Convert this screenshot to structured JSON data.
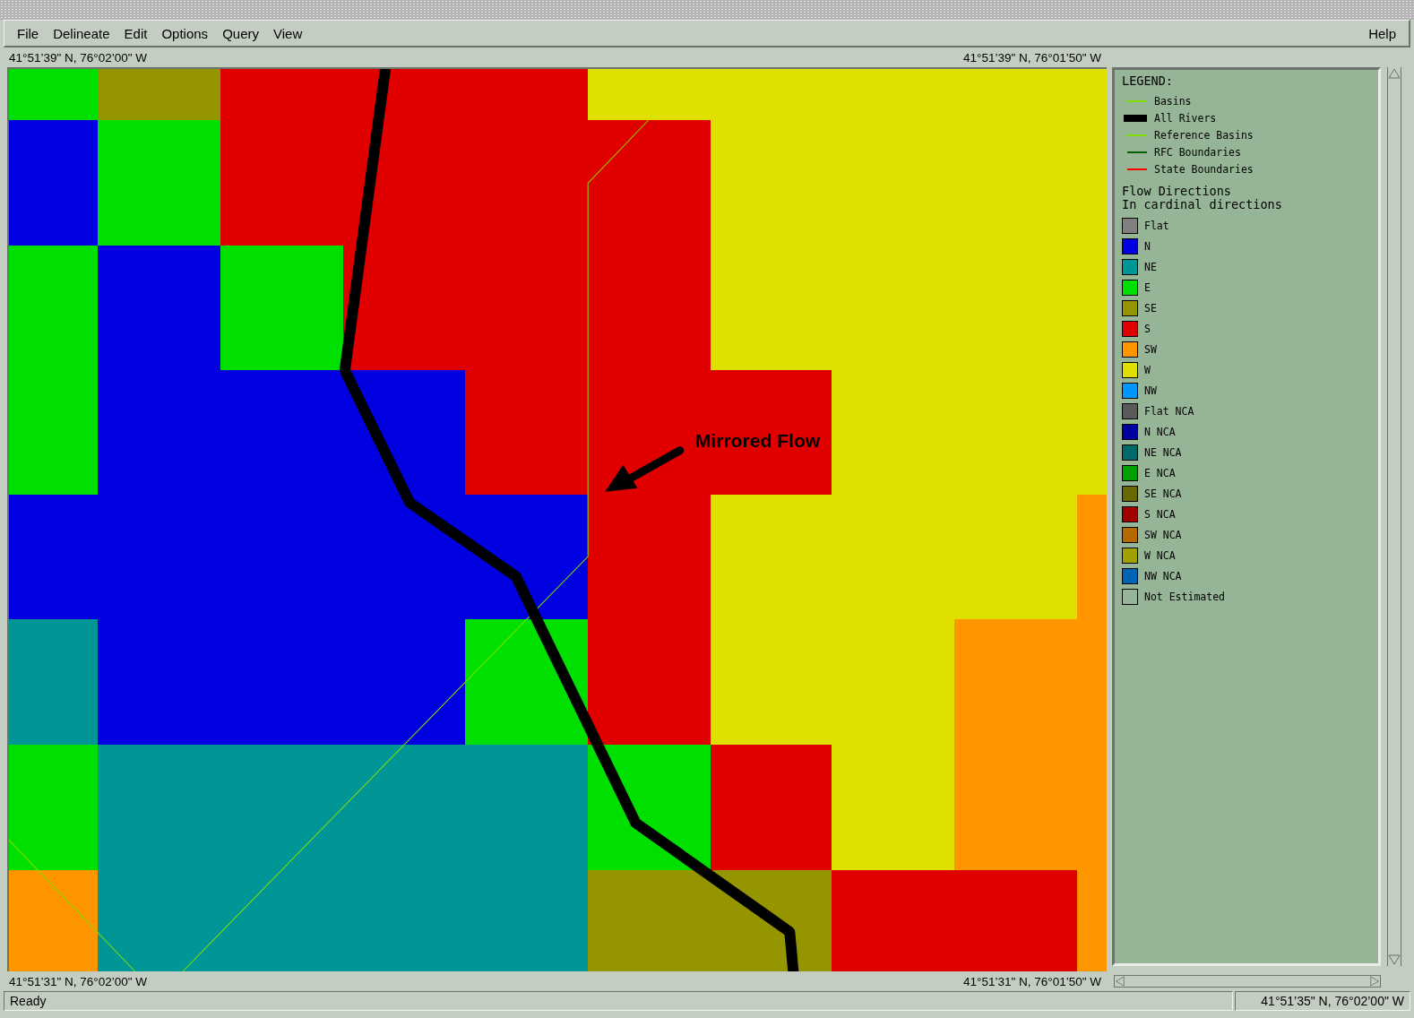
{
  "menu": {
    "left": [
      {
        "label": "File"
      },
      {
        "label": "Delineate"
      },
      {
        "label": "Edit"
      },
      {
        "label": "Options"
      },
      {
        "label": "Query"
      },
      {
        "label": "View"
      }
    ],
    "right": [
      {
        "label": "Help"
      }
    ]
  },
  "coords": {
    "top_left": "41°51’39\" N, 76°02’00\" W",
    "top_right": "41°51’39\" N, 76°01’50\" W",
    "bottom_left": "41°51’31\" N, 76°02’00\" W",
    "bottom_right": "41°51’31\" N, 76°01’50\" W"
  },
  "map": {
    "annotation": "Mirrored Flow",
    "rows": [
      {
        "cells": [
          {
            "color": "#00e000"
          },
          {
            "color": "#959500"
          },
          {
            "color": "#e00000"
          },
          {
            "color": "#e00000"
          },
          {
            "color": "#e00000"
          },
          {
            "color": "#e0e000"
          },
          {
            "color": "#e0e000"
          },
          {
            "color": "#e0e000"
          },
          {
            "color": "#e0e000"
          },
          {
            "color": "#e0e000"
          }
        ]
      },
      {
        "cells": [
          {
            "color": "#0000e0"
          },
          {
            "color": "#00e000"
          },
          {
            "color": "#e00000"
          },
          {
            "color": "#e00000"
          },
          {
            "color": "#e00000"
          },
          {
            "color": "#e00000"
          },
          {
            "color": "#e0e000"
          },
          {
            "color": "#e0e000"
          },
          {
            "color": "#e0e000"
          },
          {
            "color": "#e0e000"
          }
        ]
      },
      {
        "cells": [
          {
            "color": "#00e000"
          },
          {
            "color": "#0000e0"
          },
          {
            "color": "#00e000"
          },
          {
            "color": "#e00000"
          },
          {
            "color": "#e00000"
          },
          {
            "color": "#e00000"
          },
          {
            "color": "#e0e000"
          },
          {
            "color": "#e0e000"
          },
          {
            "color": "#e0e000"
          },
          {
            "color": "#e0e000"
          }
        ]
      },
      {
        "cells": [
          {
            "color": "#00e000"
          },
          {
            "color": "#0000e0"
          },
          {
            "color": "#0000e0"
          },
          {
            "color": "#0000e0"
          },
          {
            "color": "#e00000"
          },
          {
            "color": "#e00000"
          },
          {
            "color": "#e00000"
          },
          {
            "color": "#e0e000"
          },
          {
            "color": "#e0e000"
          },
          {
            "color": "#e0e000"
          }
        ]
      },
      {
        "cells": [
          {
            "color": "#0000e0"
          },
          {
            "color": "#0000e0"
          },
          {
            "color": "#0000e0"
          },
          {
            "color": "#0000e0"
          },
          {
            "color": "#0000e0"
          },
          {
            "color": "#e00000"
          },
          {
            "color": "#e0e000"
          },
          {
            "color": "#e0e000"
          },
          {
            "color": "#e0e000"
          },
          {
            "color": "#ff9600"
          }
        ]
      },
      {
        "cells": [
          {
            "color": "#009696"
          },
          {
            "color": "#0000e0"
          },
          {
            "color": "#0000e0"
          },
          {
            "color": "#0000e0"
          },
          {
            "color": "#00e000"
          },
          {
            "color": "#e00000"
          },
          {
            "color": "#e0e000"
          },
          {
            "color": "#e0e000"
          },
          {
            "color": "#ff9600"
          },
          {
            "color": "#ff9600"
          }
        ]
      },
      {
        "cells": [
          {
            "color": "#00e000"
          },
          {
            "color": "#009696"
          },
          {
            "color": "#009696"
          },
          {
            "color": "#009696"
          },
          {
            "color": "#009696"
          },
          {
            "color": "#00e000"
          },
          {
            "color": "#e00000"
          },
          {
            "color": "#e0e000"
          },
          {
            "color": "#ff9600"
          },
          {
            "color": "#ff9600"
          }
        ]
      },
      {
        "cells": [
          {
            "color": "#ff9600"
          },
          {
            "color": "#009696"
          },
          {
            "color": "#009696"
          },
          {
            "color": "#009696"
          },
          {
            "color": "#009696"
          },
          {
            "color": "#959500"
          },
          {
            "color": "#959500"
          },
          {
            "color": "#e00000"
          },
          {
            "color": "#e00000"
          },
          {
            "color": "#ff9600"
          }
        ]
      }
    ]
  },
  "legend": {
    "title": "LEGEND:",
    "layers": [
      {
        "kind": "line",
        "label": "Basins",
        "color": "#80e000"
      },
      {
        "kind": "thick",
        "label": "All Rivers",
        "color": "#000000"
      },
      {
        "kind": "line",
        "label": "Reference Basins",
        "color": "#80e000"
      },
      {
        "kind": "line",
        "label": "RFC Boundaries",
        "color": "#006000"
      },
      {
        "kind": "line",
        "label": "State Boundaries",
        "color": "#ff0000"
      }
    ],
    "heading": [
      "Flow Directions",
      "In cardinal directions"
    ],
    "classes": [
      {
        "label": "Flat",
        "color": "#808080"
      },
      {
        "label": "N",
        "color": "#0000e0"
      },
      {
        "label": "NE",
        "color": "#009696"
      },
      {
        "label": "E",
        "color": "#00e000"
      },
      {
        "label": "SE",
        "color": "#959500"
      },
      {
        "label": "S",
        "color": "#e00000"
      },
      {
        "label": "SW",
        "color": "#ff9600"
      },
      {
        "label": "W",
        "color": "#e0e000"
      },
      {
        "label": "NW",
        "color": "#0096ff"
      },
      {
        "label": "Flat NCA",
        "color": "#5a5a5a"
      },
      {
        "label": "N NCA",
        "color": "#0000a0"
      },
      {
        "label": "NE NCA",
        "color": "#006a6a"
      },
      {
        "label": "E NCA",
        "color": "#00a000"
      },
      {
        "label": "SE NCA",
        "color": "#686800"
      },
      {
        "label": "S NCA",
        "color": "#a00000"
      },
      {
        "label": "SW NCA",
        "color": "#b46a00"
      },
      {
        "label": "W NCA",
        "color": "#a0a000"
      },
      {
        "label": "NW NCA",
        "color": "#0064b4"
      },
      {
        "label": "Not Estimated",
        "color": "#96b496"
      }
    ]
  },
  "status_bar": {
    "message": "Ready",
    "position": "41°51’35\" N, 76°02’00\" W"
  }
}
